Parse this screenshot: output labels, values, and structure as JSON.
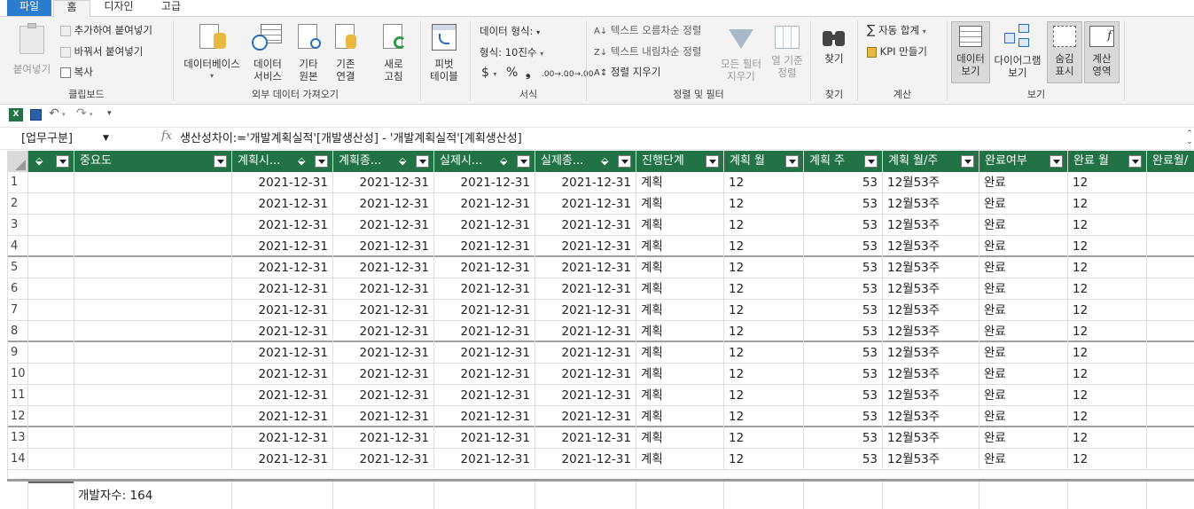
{
  "ribbon_tabs": {
    "file": "파일",
    "home": "홈",
    "design": "디자인",
    "advanced": "고급"
  },
  "clipboard": {
    "paste": "붙여넣기",
    "paste_append": "추가하여 붙여넣기",
    "paste_replace": "바꿔서 붙여넣기",
    "copy": "복사",
    "label": "클립보드"
  },
  "external": {
    "database": "데이터베이스",
    "data_service_1": "데이터",
    "data_service_2": "서비스",
    "other_1": "기타",
    "other_2": "원본",
    "existing_1": "기존",
    "existing_2": "연결",
    "refresh_1": "새로",
    "refresh_2": "고침",
    "label": "외부 데이터 가져오기"
  },
  "pivot": {
    "label_1": "피벗",
    "label_2": "테이블"
  },
  "format": {
    "data_format": "데이터 형식:",
    "format": "형식: 10진수",
    "currency": "$",
    "percent": "%",
    "comma": "❟",
    "inc_dec": ".00→.0",
    "dec_dec": ".0→.00",
    "label": "서식"
  },
  "sort": {
    "asc": "텍스트 오름차순 정렬",
    "desc": "텍스트 내림차순 정렬",
    "clear": "정렬 지우기",
    "clear_filters_1": "모든 필터",
    "clear_filters_2": "지우기",
    "sort_by_1": "열 기준",
    "sort_by_2": "정렬",
    "label": "정렬 및 필터"
  },
  "find": {
    "button": "찾기",
    "label": "찾기"
  },
  "calc": {
    "autosum": "자동 합계",
    "kpi": "KPI 만들기",
    "label": "계산"
  },
  "view": {
    "data_view_1": "데이터",
    "data_view_2": "보기",
    "diagram_1": "다이어그램",
    "diagram_2": "보기",
    "hidden_1": "숨김",
    "hidden_2": "표시",
    "calc_area_1": "계산",
    "calc_area_2": "영역",
    "label": "보기"
  },
  "formula_bar": {
    "name_box": "[업무구분]",
    "fx": "fx",
    "formula": "생산성차이:='개발계획실적'[개발생산성] - '개발계획실적'[계획생산성]"
  },
  "columns": [
    "",
    "중요도",
    "계획시...",
    "계획종...",
    "실제시...",
    "실제종...",
    "진행단계",
    "계획 월",
    "계획 주",
    "계획 월/주",
    "완료여부",
    "완료 월",
    "완료월/"
  ],
  "rows": [
    {
      "n": "1",
      "d1": "2021-12-31",
      "d2": "2021-12-31",
      "d3": "2021-12-31",
      "d4": "2021-12-31",
      "stage": "계획",
      "pm": "12",
      "pw": "53",
      "pmw": "12월53주",
      "done": "완료",
      "dm": "12"
    },
    {
      "n": "2",
      "d1": "2021-12-31",
      "d2": "2021-12-31",
      "d3": "2021-12-31",
      "d4": "2021-12-31",
      "stage": "계획",
      "pm": "12",
      "pw": "53",
      "pmw": "12월53주",
      "done": "완료",
      "dm": "12"
    },
    {
      "n": "3",
      "d1": "2021-12-31",
      "d2": "2021-12-31",
      "d3": "2021-12-31",
      "d4": "2021-12-31",
      "stage": "계획",
      "pm": "12",
      "pw": "53",
      "pmw": "12월53주",
      "done": "완료",
      "dm": "12"
    },
    {
      "n": "4",
      "d1": "2021-12-31",
      "d2": "2021-12-31",
      "d3": "2021-12-31",
      "d4": "2021-12-31",
      "stage": "계획",
      "pm": "12",
      "pw": "53",
      "pmw": "12월53주",
      "done": "완료",
      "dm": "12"
    },
    {
      "n": "5",
      "d1": "2021-12-31",
      "d2": "2021-12-31",
      "d3": "2021-12-31",
      "d4": "2021-12-31",
      "stage": "계획",
      "pm": "12",
      "pw": "53",
      "pmw": "12월53주",
      "done": "완료",
      "dm": "12"
    },
    {
      "n": "6",
      "d1": "2021-12-31",
      "d2": "2021-12-31",
      "d3": "2021-12-31",
      "d4": "2021-12-31",
      "stage": "계획",
      "pm": "12",
      "pw": "53",
      "pmw": "12월53주",
      "done": "완료",
      "dm": "12"
    },
    {
      "n": "7",
      "d1": "2021-12-31",
      "d2": "2021-12-31",
      "d3": "2021-12-31",
      "d4": "2021-12-31",
      "stage": "계획",
      "pm": "12",
      "pw": "53",
      "pmw": "12월53주",
      "done": "완료",
      "dm": "12"
    },
    {
      "n": "8",
      "d1": "2021-12-31",
      "d2": "2021-12-31",
      "d3": "2021-12-31",
      "d4": "2021-12-31",
      "stage": "계획",
      "pm": "12",
      "pw": "53",
      "pmw": "12월53주",
      "done": "완료",
      "dm": "12"
    },
    {
      "n": "9",
      "d1": "2021-12-31",
      "d2": "2021-12-31",
      "d3": "2021-12-31",
      "d4": "2021-12-31",
      "stage": "계획",
      "pm": "12",
      "pw": "53",
      "pmw": "12월53주",
      "done": "완료",
      "dm": "12"
    },
    {
      "n": "10",
      "d1": "2021-12-31",
      "d2": "2021-12-31",
      "d3": "2021-12-31",
      "d4": "2021-12-31",
      "stage": "계획",
      "pm": "12",
      "pw": "53",
      "pmw": "12월53주",
      "done": "완료",
      "dm": "12"
    },
    {
      "n": "11",
      "d1": "2021-12-31",
      "d2": "2021-12-31",
      "d3": "2021-12-31",
      "d4": "2021-12-31",
      "stage": "계획",
      "pm": "12",
      "pw": "53",
      "pmw": "12월53주",
      "done": "완료",
      "dm": "12"
    },
    {
      "n": "12",
      "d1": "2021-12-31",
      "d2": "2021-12-31",
      "d3": "2021-12-31",
      "d4": "2021-12-31",
      "stage": "계획",
      "pm": "12",
      "pw": "53",
      "pmw": "12월53주",
      "done": "완료",
      "dm": "12"
    },
    {
      "n": "13",
      "d1": "2021-12-31",
      "d2": "2021-12-31",
      "d3": "2021-12-31",
      "d4": "2021-12-31",
      "stage": "계획",
      "pm": "12",
      "pw": "53",
      "pmw": "12월53주",
      "done": "완료",
      "dm": "12"
    },
    {
      "n": "14",
      "d1": "2021-12-31",
      "d2": "2021-12-31",
      "d3": "2021-12-31",
      "d4": "2021-12-31",
      "stage": "계획",
      "pm": "12",
      "pw": "53",
      "pmw": "12월53주",
      "done": "완료",
      "dm": "12"
    }
  ],
  "calc_area": {
    "measure": "개발자수: 164"
  },
  "colors": {
    "header_green": "#217346",
    "file_tab_blue": "#2a7ccf"
  }
}
